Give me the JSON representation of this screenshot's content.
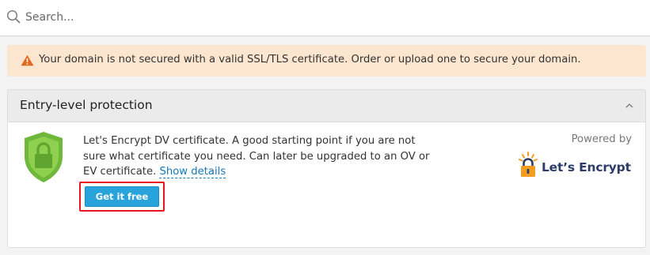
{
  "search": {
    "placeholder": "Search...",
    "value": ""
  },
  "alert": {
    "icon": "warning-triangle-icon",
    "text": "Your domain is not secured with a valid SSL/TLS certificate. Order or upload one to secure your domain.",
    "color": "#fde6d0"
  },
  "card": {
    "title": "Entry-level protection",
    "toggle_icon": "chevron-up-icon",
    "product_icon": "shield-lock-icon",
    "description": "Let's Encrypt DV certificate. A good starting point if you are not sure what certificate you need. Can later be upgraded to an OV or EV certificate.",
    "show_details_label": "Show details",
    "action_label": "Get it free",
    "powered_by": "Powered by",
    "provider_logo_text": "Let’s Encrypt"
  },
  "colors": {
    "accent": "#29a3dc",
    "link": "#1676b8",
    "highlight": "#e8141f",
    "shield": "#7ac142",
    "provider_brand": "#2c3c69"
  }
}
